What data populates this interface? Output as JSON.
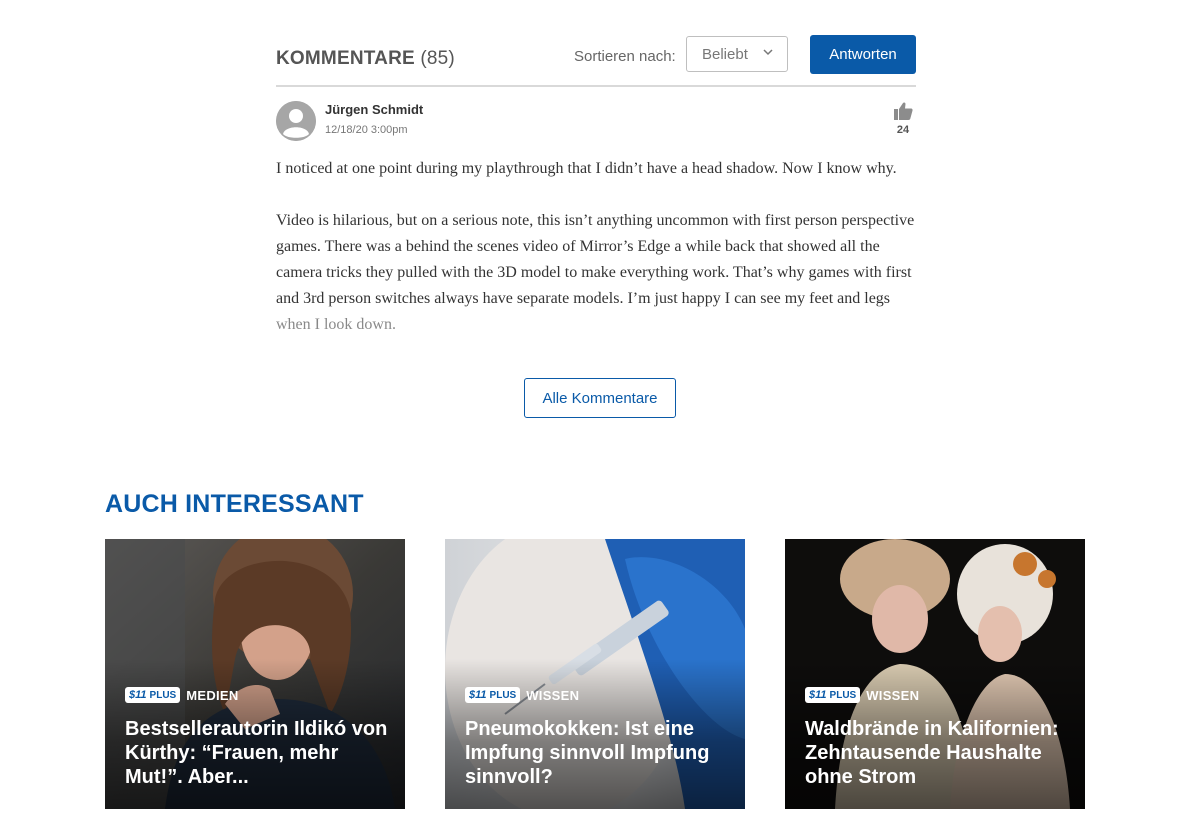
{
  "comments": {
    "title": "KOMMENTARE",
    "count": "(85)",
    "sort_label": "Sortieren nach:",
    "sort_value": "Beliebt",
    "reply_label": "Antworten",
    "items": [
      {
        "author": "Jürgen Schmidt",
        "date": "12/18/20 3:00pm",
        "likes": "24",
        "paragraphs": [
          "I noticed at one point during my playthrough that I didn’t have a head shadow. Now I know why.",
          "Video is hilarious, but on a serious note, this isn’t anything uncommon with first person perspective games. There was a behind the scenes video of Mirror’s Edge a while back that showed all the camera tricks they pulled with the 3D model to make everything work. That’s why games with first and 3rd person switches always have separate models. I’m just happy I can see my feet and legs when I look down."
        ]
      }
    ],
    "all_comments_label": "Alle Kommentare"
  },
  "related": {
    "title": "AUCH INTERESSANT",
    "badge_logo": "$11",
    "badge_text": "PLUS",
    "cards": [
      {
        "category": "MEDIEN",
        "headline": "Bestsellerautorin Ildikó von Kürthy: “Frauen, mehr Mut!”. Aber..."
      },
      {
        "category": "WISSEN",
        "headline": "Pneumokokken: Ist eine Impfung sinnvoll Impfung sinnvoll?"
      },
      {
        "category": "WISSEN",
        "headline": "Waldbrände in Kalifornien: Zehntausende Haushalte ohne Strom"
      }
    ]
  },
  "colors": {
    "accent": "#0a5aa8",
    "text": "#333333",
    "divider": "#d9d9d9"
  },
  "icons": [
    "avatar-user-icon",
    "chevron-down-icon",
    "thumbs-up-icon"
  ]
}
